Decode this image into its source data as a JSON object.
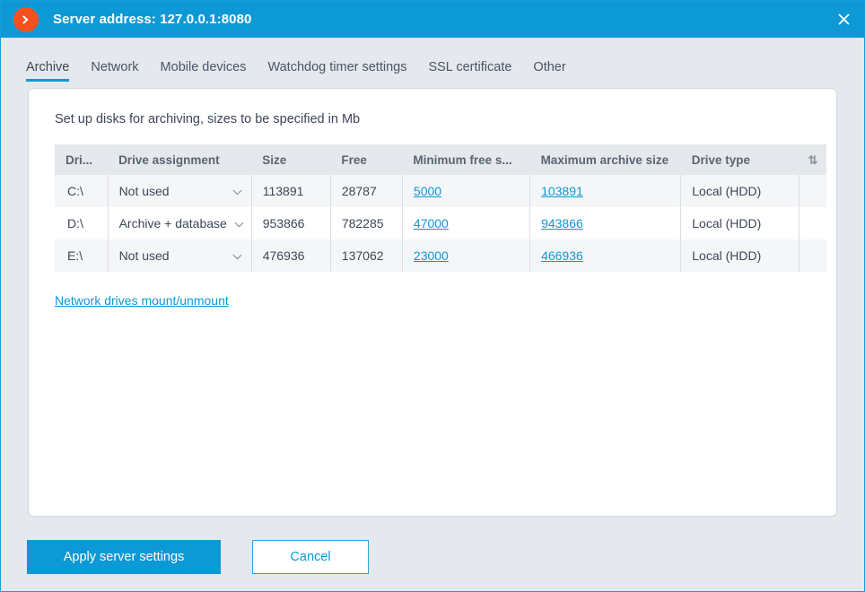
{
  "titlebar": {
    "logo_icon": "chevron-right-circle-icon",
    "title": "Server address: 127.0.0.1:8080",
    "close_icon": "close-icon",
    "bar_color": "#0d99d5",
    "logo_color": "#f4511e"
  },
  "tabs": [
    {
      "label": "Archive",
      "active": true
    },
    {
      "label": "Network",
      "active": false
    },
    {
      "label": "Mobile devices",
      "active": false
    },
    {
      "label": "Watchdog timer settings",
      "active": false
    },
    {
      "label": "SSL certificate",
      "active": false
    },
    {
      "label": "Other",
      "active": false
    }
  ],
  "main": {
    "card_title": "Set up disks for archiving, sizes to be specified in Mb",
    "table": {
      "columns": [
        "Dri...",
        "Drive assignment",
        "Size",
        "Free",
        "Minimum free s...",
        "Maximum archive size",
        "Drive type"
      ],
      "sort_icon": "sort-updown-icon",
      "rows": [
        {
          "drive": "C:\\",
          "assignment": "Not used",
          "size": "113891",
          "free": "28787",
          "min_free": "5000",
          "max_archive": "103891",
          "drive_type": "Local (HDD)"
        },
        {
          "drive": "D:\\",
          "assignment": "Archive + database",
          "size": "953866",
          "free": "782285",
          "min_free": "47000",
          "max_archive": "943866",
          "drive_type": "Local (HDD)"
        },
        {
          "drive": "E:\\",
          "assignment": "Not used",
          "size": "476936",
          "free": "137062",
          "min_free": "23000",
          "max_archive": "466936",
          "drive_type": "Local (HDD)"
        }
      ]
    },
    "network_drives_link": "Network drives mount/unmount"
  },
  "footer": {
    "apply_label": "Apply server settings",
    "cancel_label": "Cancel"
  },
  "colors": {
    "accent": "#0d99d5",
    "link": "#0d99d5",
    "page_bg": "#e5e8ec",
    "row_alt": "#f5f6f8"
  }
}
